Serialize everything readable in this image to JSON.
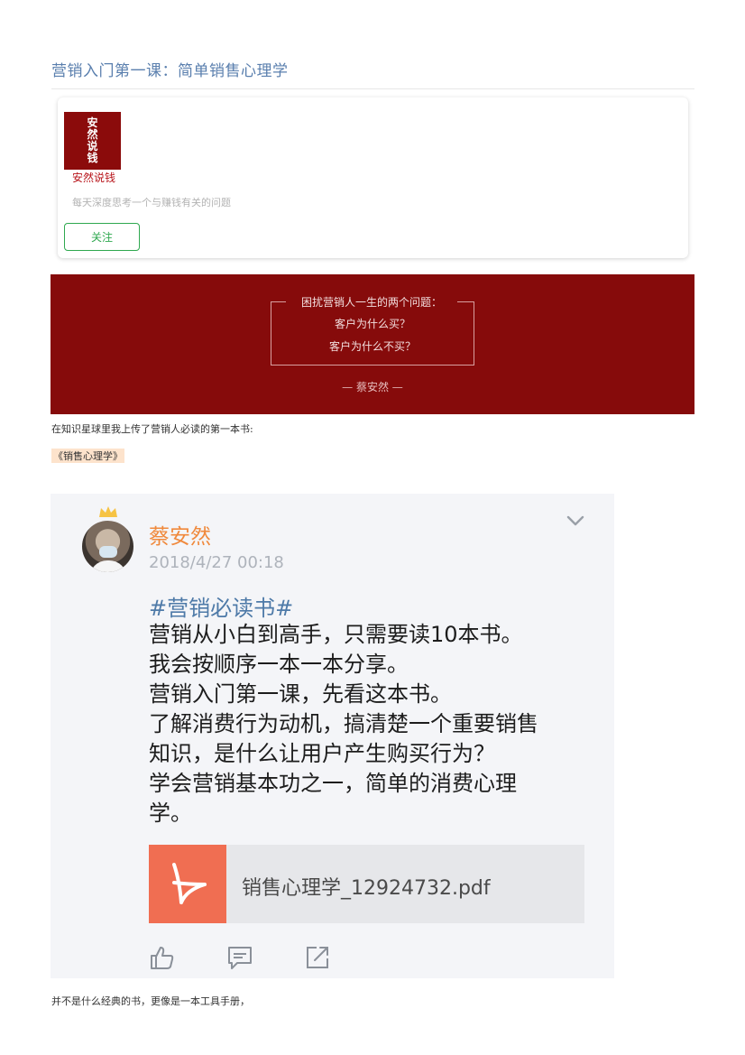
{
  "article": {
    "title": "营销入门第一课：简单销售心理学"
  },
  "account": {
    "logo_chars": [
      "安",
      "然",
      "说",
      "钱"
    ],
    "name": "安然说钱",
    "description": "每天深度思考一个与赚钱有关的问题",
    "follow_label": "关注"
  },
  "banner": {
    "heading": "困扰营销人一生的两个问题：",
    "line1": "客户为什么买？",
    "line2": "客户为什么不买？",
    "signature": "— 蔡安然 —",
    "background": "#860b0b"
  },
  "body": {
    "intro": "在知识星球里我上传了营销人必读的第一本书:",
    "book_tag": "《销售心理学》",
    "outro": "并不是什么经典的书，更像是一本工具手册，"
  },
  "post": {
    "author": "蔡安然",
    "date": "2018/4/27 00:18",
    "hashtag": "#营销必读书#",
    "lines": [
      "营销从小白到高手，只需要读10本书。",
      "我会按顺序一本一本分享。",
      "营销入门第一课，先看这本书。",
      "了解消费行为动机，搞清楚一个重要销售",
      "知识，是什么让用户产生购买行为？",
      "学会营销基本功之一，简单的消费心理",
      "学。"
    ],
    "file_name": "销售心理学_12924732.pdf",
    "file_icon": "pdf-icon",
    "accent_color": "#f0893c",
    "file_color": "#f06e52"
  }
}
